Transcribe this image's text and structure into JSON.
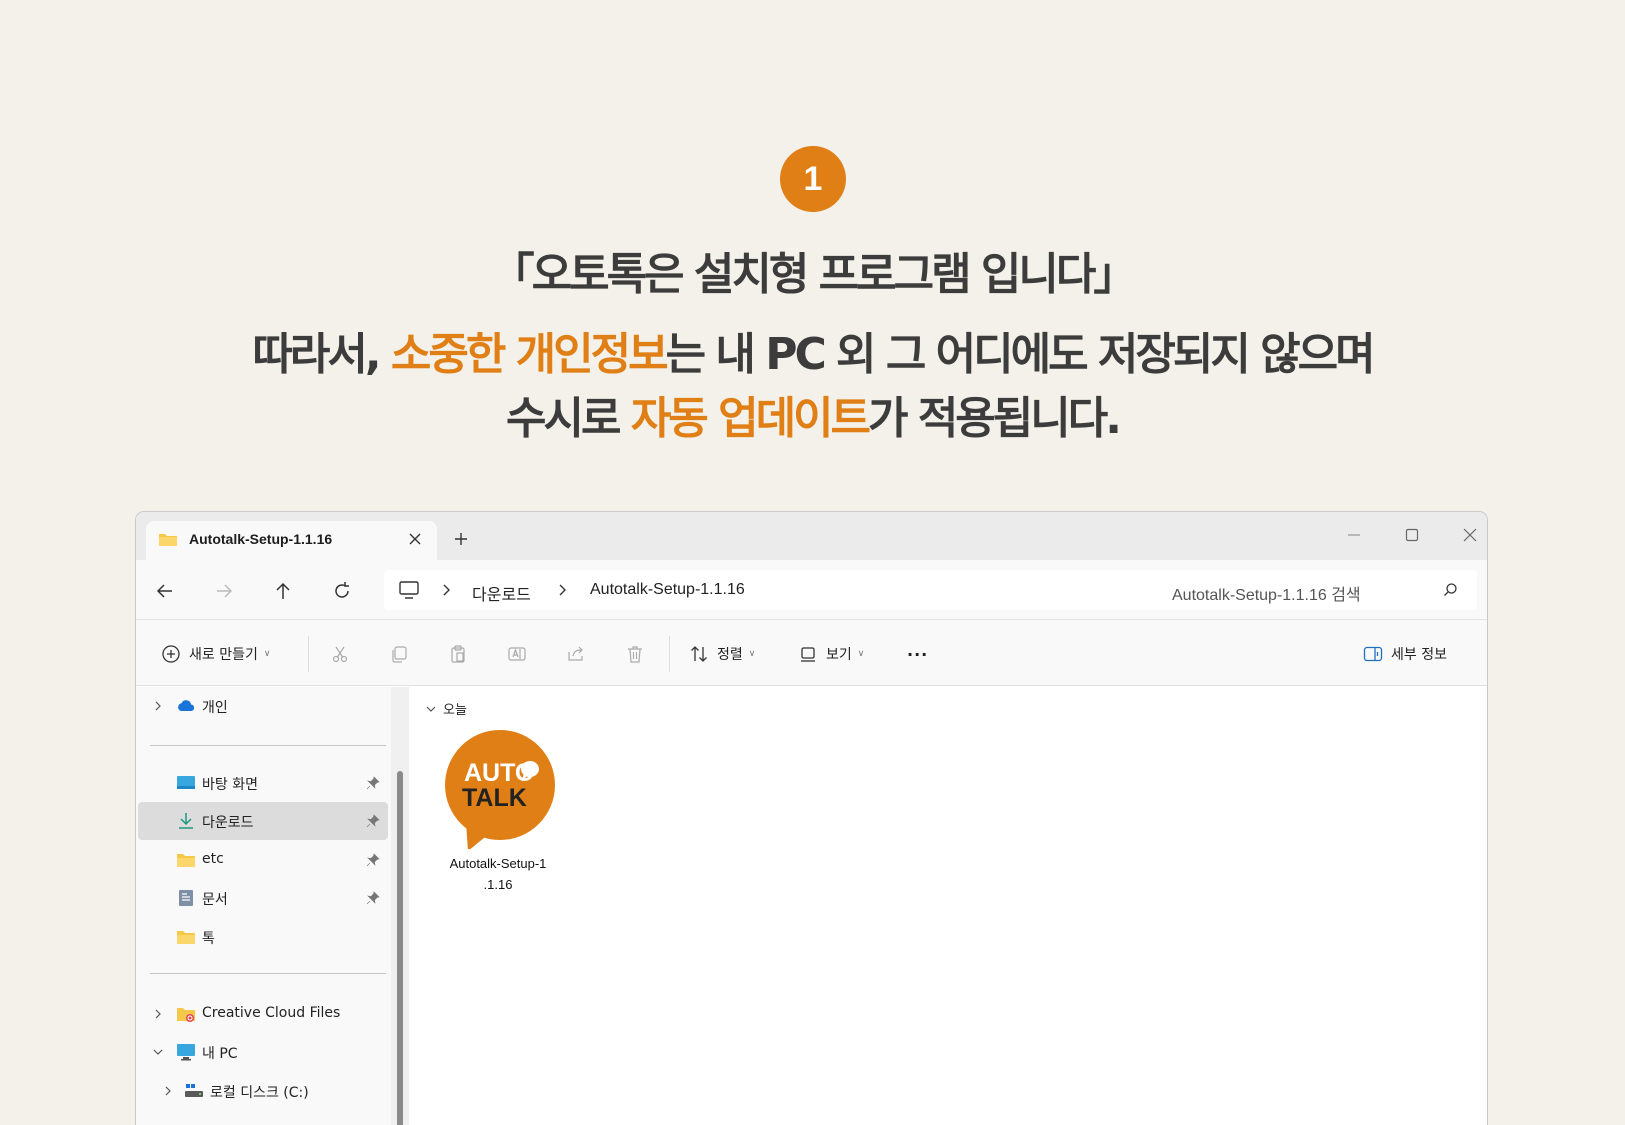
{
  "step": {
    "number": "1"
  },
  "headline": {
    "line1": "「오토톡은 설치형 프로그램 입니다」",
    "line2_pre": "따라서, ",
    "line2_hl": "소중한 개인정보",
    "line2_post": "는 내 PC 외 그 어디에도 저장되지 않으며",
    "line3_pre": "수시로 ",
    "line3_hl": "자동 업데이트",
    "line3_post": "가 적용됩니다."
  },
  "colors": {
    "accent": "#e07f16",
    "background": "#f3f1ea"
  },
  "window": {
    "tab_title": "Autotalk-Setup-1.1.16",
    "breadcrumb": [
      "다운로드",
      "Autotalk-Setup-1.1.16"
    ],
    "search_placeholder": "Autotalk-Setup-1.1.16 검색"
  },
  "toolbar": {
    "new_label": "새로 만들기",
    "sort_label": "정렬",
    "view_label": "보기",
    "more_label": "···",
    "details_label": "세부 정보"
  },
  "sidebar": {
    "cloud_item": "개인",
    "quick_access": [
      "바탕 화면",
      "다운로드",
      "etc",
      "문서",
      "톡"
    ],
    "cc_files": "Creative Cloud Files",
    "this_pc": "내 PC",
    "local_disk": "로컬 디스크 (C:)"
  },
  "content": {
    "group_header": "오늘",
    "file": {
      "name_line1": "Autotalk-Setup-1",
      "name_line2": ".1.16",
      "logo_line1": "AUTO",
      "logo_line2": "TALK"
    }
  }
}
